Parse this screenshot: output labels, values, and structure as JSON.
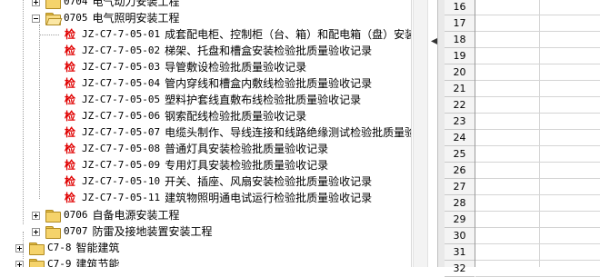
{
  "tree": {
    "rows": [
      {
        "code": "0704",
        "label": "电气动力安装工程",
        "kind": "folder",
        "expanded": false
      },
      {
        "code": "0705",
        "label": "电气照明安装工程",
        "kind": "folder",
        "expanded": true
      },
      {
        "code": "JZ-C7-7-05-01",
        "label": "成套配电柜、控制柜（台、箱）和配电箱（盘）安装检验批质量验收记录",
        "kind": "form",
        "badge": "检"
      },
      {
        "code": "JZ-C7-7-05-02",
        "label": "梯架、托盘和槽盒安装检验批质量验收记录",
        "kind": "form",
        "badge": "检"
      },
      {
        "code": "JZ-C7-7-05-03",
        "label": "导管敷设检验批质量验收记录",
        "kind": "form",
        "badge": "检"
      },
      {
        "code": "JZ-C7-7-05-04",
        "label": "管内穿线和槽盒内敷线检验批质量验收记录",
        "kind": "form",
        "badge": "检"
      },
      {
        "code": "JZ-C7-7-05-05",
        "label": "塑料护套线直敷布线检验批质量验收记录",
        "kind": "form",
        "badge": "检"
      },
      {
        "code": "JZ-C7-7-05-06",
        "label": "钢索配线检验批质量验收记录",
        "kind": "form",
        "badge": "检"
      },
      {
        "code": "JZ-C7-7-05-07",
        "label": "电缆头制作、导线连接和线路绝缘测试检验批质量验收记录",
        "kind": "form",
        "badge": "检"
      },
      {
        "code": "JZ-C7-7-05-08",
        "label": "普通灯具安装检验批质量验收记录",
        "kind": "form",
        "badge": "检"
      },
      {
        "code": "JZ-C7-7-05-09",
        "label": "专用灯具安装检验批质量验收记录",
        "kind": "form",
        "badge": "检"
      },
      {
        "code": "JZ-C7-7-05-10",
        "label": "开关、插座、风扇安装检验批质量验收记录",
        "kind": "form",
        "badge": "检"
      },
      {
        "code": "JZ-C7-7-05-11",
        "label": "建筑物照明通电试运行检验批质量验收记录",
        "kind": "form",
        "badge": "检"
      },
      {
        "code": "0706",
        "label": "自备电源安装工程",
        "kind": "folder",
        "expanded": false
      },
      {
        "code": "0707",
        "label": "防雷及接地装置安装工程",
        "kind": "folder",
        "expanded": false
      },
      {
        "code": "C7-8",
        "label": "智能建筑",
        "kind": "folder",
        "expanded": false
      },
      {
        "code": "C7-9",
        "label": "建筑节能",
        "kind": "folder",
        "expanded": false
      }
    ]
  },
  "splitter": {
    "collapse_glyph": "◀"
  },
  "sheet": {
    "row_numbers": [
      "16",
      "17",
      "18",
      "19",
      "20",
      "21",
      "22",
      "23",
      "24",
      "25",
      "26",
      "27",
      "28",
      "29",
      "30",
      "31",
      "32"
    ]
  },
  "colors": {
    "badge": "#e00000",
    "folder": "#f5d36b"
  }
}
